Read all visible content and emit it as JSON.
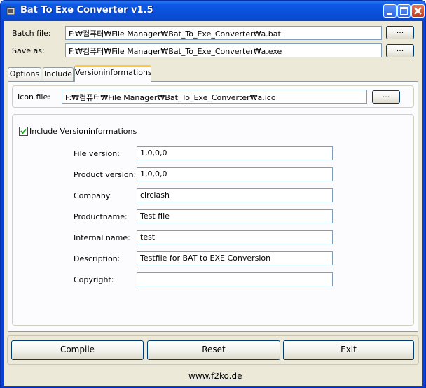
{
  "window": {
    "title": "Bat To Exe Converter v1.5"
  },
  "top": {
    "batch_label": "Batch file:",
    "batch_value": "F:₩컴퓨터₩File Manager₩Bat_To_Exe_Converter₩a.bat",
    "save_label": "Save as:",
    "save_value": "F:₩컴퓨터₩File Manager₩Bat_To_Exe_Converter₩a.exe",
    "browse_label": "..."
  },
  "tabs": [
    "Options",
    "Include",
    "Versioninformations"
  ],
  "version": {
    "icon_label": "Icon file:",
    "icon_value": "F:₩컴퓨터₩File Manager₩Bat_To_Exe_Converter₩a.ico",
    "include_label": "Include Versioninformations",
    "include_checked": true,
    "fields": [
      {
        "label": "File version:",
        "value": "1,0,0,0"
      },
      {
        "label": "Product version:",
        "value": "1,0,0,0"
      },
      {
        "label": "Company:",
        "value": "circlash"
      },
      {
        "label": "Productname:",
        "value": "Test file"
      },
      {
        "label": "Internal name:",
        "value": "test"
      },
      {
        "label": "Description:",
        "value": "Testfile for BAT to EXE Conversion"
      },
      {
        "label": "Copyright:",
        "value": ""
      }
    ]
  },
  "buttons": {
    "compile": "Compile",
    "reset": "Reset",
    "exit": "Exit"
  },
  "footer": {
    "link": "www.f2ko.de"
  }
}
